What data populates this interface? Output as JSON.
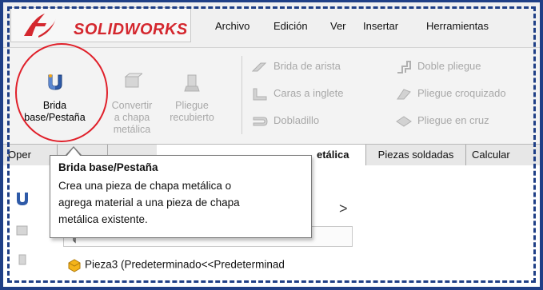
{
  "brand": {
    "ds": "3S",
    "name": "SOLIDWORKS",
    "color": "#d4272e"
  },
  "menu": [
    "Archivo",
    "Edición",
    "Ver",
    "Insertar",
    "Herramientas"
  ],
  "ribbon": {
    "brida_base": {
      "line1": "Brida",
      "line2": "base/Pestaña",
      "icon": "base-flange-icon"
    },
    "convertir": {
      "line1": "Convertir",
      "line2": "a chapa",
      "line3": "metálica",
      "icon": "convert-sheet-metal-icon"
    },
    "pliegue_recubierto": {
      "line1": "Pliegue",
      "line2": "recubierto",
      "icon": "lofted-bend-icon"
    },
    "small": [
      {
        "label": "Brida de arista",
        "icon": "edge-flange-icon"
      },
      {
        "label": "Caras a inglete",
        "icon": "miter-flange-icon"
      },
      {
        "label": "Dobladillo",
        "icon": "hem-icon"
      },
      {
        "label": "Doble pliegue",
        "icon": "jog-icon"
      },
      {
        "label": "Pliegue croquizado",
        "icon": "sketched-bend-icon"
      },
      {
        "label": "Pliegue en cruz",
        "icon": "cross-break-icon"
      }
    ]
  },
  "tabs": {
    "t1": "Oper",
    "t2": "",
    "t3": "",
    "t4_partial": "etálica",
    "t5": "Piezas soldadas",
    "t6": "Calcular"
  },
  "tooltip": {
    "title": "Brida base/Pestaña",
    "lines": [
      "Crea una pieza de chapa metálica o",
      "agrega material a una pieza de chapa",
      "metálica existente."
    ]
  },
  "tree": {
    "expand_arrow": ">",
    "part_label": "Pieza3  (Predeterminado<<Predeterminad",
    "part_icon": "part-icon",
    "filter_icon": "filter-icon"
  },
  "colors": {
    "highlight_circle": "#e0202a",
    "dashed_border": "#1f3f86"
  }
}
